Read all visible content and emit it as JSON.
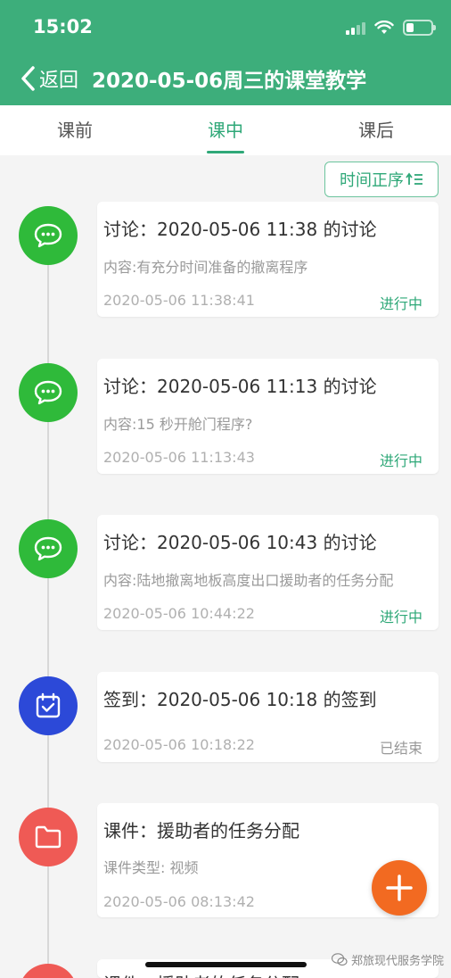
{
  "status_bar": {
    "time": "15:02"
  },
  "header": {
    "back_label": "返回",
    "title": "2020-05-06周三的课堂教学"
  },
  "tabs": [
    {
      "label": "课前"
    },
    {
      "label": "课中",
      "active": true
    },
    {
      "label": "课后"
    }
  ],
  "sort_button": {
    "label": "时间正序"
  },
  "timeline": [
    {
      "type": "discussion",
      "icon": "chat-icon",
      "color": "#2fba3a",
      "title": "讨论：2020-05-06 11:38 的讨论",
      "content": "内容:有充分时间准备的撤离程序",
      "time": "2020-05-06 11:38:41",
      "status": "进行中"
    },
    {
      "type": "discussion",
      "icon": "chat-icon",
      "color": "#2fba3a",
      "title": "讨论：2020-05-06 11:13 的讨论",
      "content": "内容:15 秒开舱门程序?",
      "time": "2020-05-06 11:13:43",
      "status": "进行中"
    },
    {
      "type": "discussion",
      "icon": "chat-icon",
      "color": "#2fba3a",
      "title": "讨论：2020-05-06 10:43 的讨论",
      "content": "内容:陆地撤离地板高度出口援助者的任务分配",
      "time": "2020-05-06 10:44:22",
      "status": "进行中"
    },
    {
      "type": "sign-in",
      "icon": "calendar-check-icon",
      "color": "#2c49d8",
      "title": "签到：2020-05-06 10:18 的签到",
      "time": "2020-05-06 10:18:22",
      "status": "已结束"
    },
    {
      "type": "courseware",
      "icon": "folder-icon",
      "color": "#ef5a55",
      "title": "课件：援助者的任务分配",
      "content": "课件类型: 视频",
      "time": "2020-05-06 08:13:42"
    },
    {
      "type": "courseware",
      "icon": "folder-icon",
      "color": "#ef5a55",
      "title": "课件：援助者的任务分配"
    }
  ],
  "fab": {
    "icon": "plus-icon"
  },
  "watermark": {
    "text": "郑旅现代服务学院"
  }
}
